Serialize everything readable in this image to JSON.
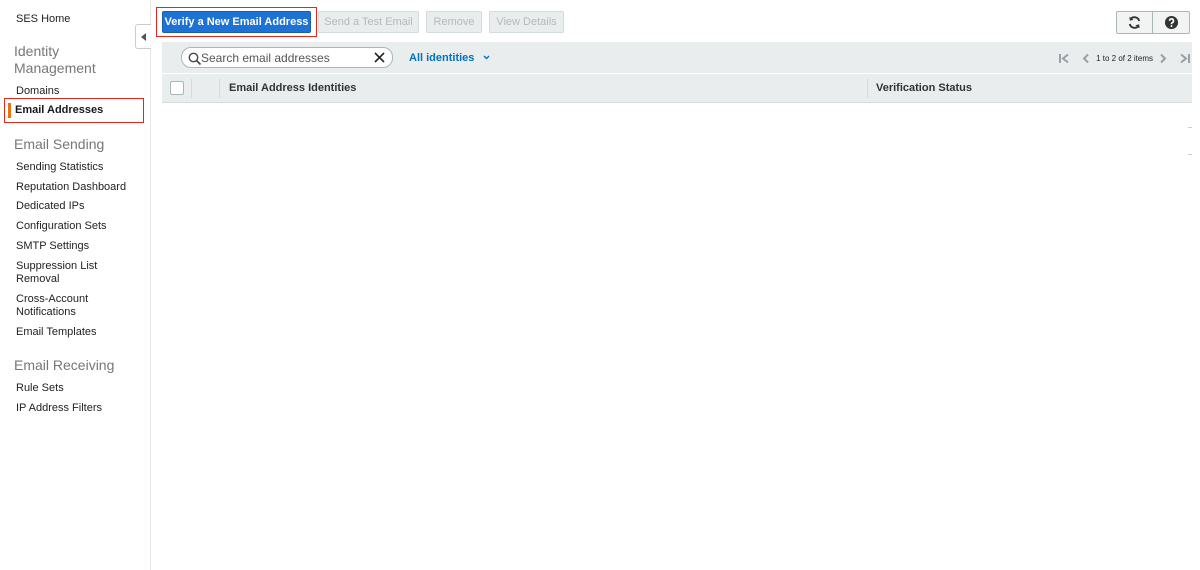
{
  "sidebar": {
    "home": "SES Home",
    "identity_section": "Identity Management",
    "domains": "Domains",
    "email_addresses": "Email Addresses",
    "sending_section": "Email Sending",
    "sending_items": [
      "Sending Statistics",
      "Reputation Dashboard",
      "Dedicated IPs",
      "Configuration Sets",
      "SMTP Settings",
      "Suppression List Removal",
      "Cross-Account Notifications",
      "Email Templates"
    ],
    "receiving_section": "Email Receiving",
    "receiving_items": [
      "Rule Sets",
      "IP Address Filters"
    ]
  },
  "toolbar": {
    "verify_label": "Verify a New Email Address",
    "send_test_label": "Send a Test Email",
    "remove_label": "Remove",
    "view_details_label": "View Details",
    "refresh_icon": "refresh-icon",
    "help_icon": "help-icon"
  },
  "filter": {
    "search_placeholder": "Search email addresses",
    "search_value": "",
    "identities_filter": "All identities"
  },
  "pagination": {
    "text": "1 to 2 of 2 items"
  },
  "table": {
    "columns": [
      "Email Address Identities",
      "Verification Status"
    ],
    "rows": []
  },
  "colors": {
    "primary_button": "#1d72d3",
    "highlight_outline": "#e0281b",
    "active_indicator": "#ec7211",
    "link": "#0073bb"
  }
}
